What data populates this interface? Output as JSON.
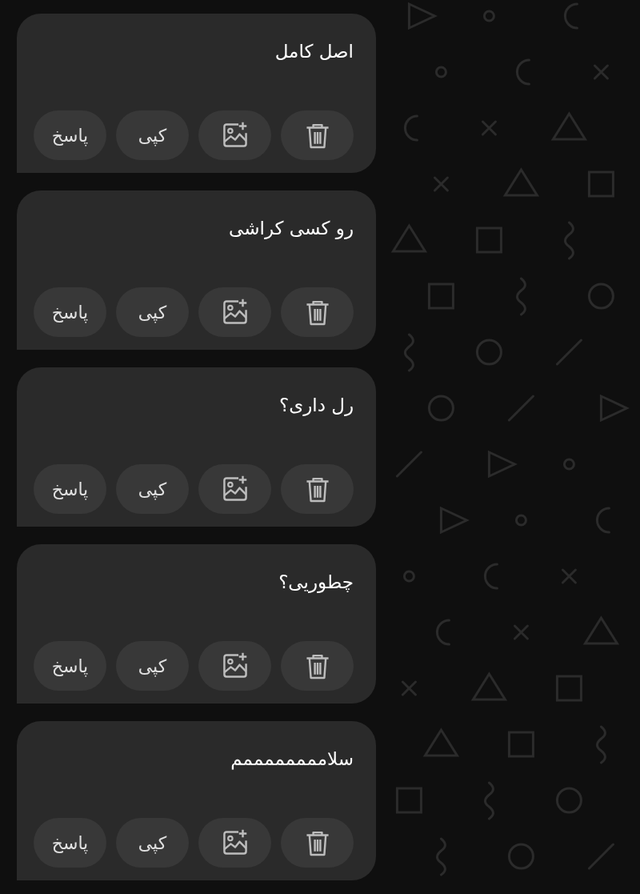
{
  "messages": [
    {
      "text": "اصل کامل",
      "actions": [
        {
          "kind": "delete"
        },
        {
          "kind": "add_image"
        },
        {
          "kind": "text",
          "label": "کپی"
        },
        {
          "kind": "text",
          "label": "پاسخ"
        }
      ]
    },
    {
      "text": "رو کسی کراشی",
      "actions": [
        {
          "kind": "delete"
        },
        {
          "kind": "add_image"
        },
        {
          "kind": "text",
          "label": "کپی"
        },
        {
          "kind": "text",
          "label": "پاسخ"
        }
      ]
    },
    {
      "text": "رل داری؟",
      "actions": [
        {
          "kind": "delete"
        },
        {
          "kind": "add_image"
        },
        {
          "kind": "text",
          "label": "کپی"
        },
        {
          "kind": "text",
          "label": "پاسخ"
        }
      ]
    },
    {
      "text": "چطوریی؟",
      "actions": [
        {
          "kind": "delete"
        },
        {
          "kind": "add_image"
        },
        {
          "kind": "text",
          "label": "کپی"
        },
        {
          "kind": "text",
          "label": "پاسخ"
        }
      ]
    },
    {
      "text": "سلاممممممممم",
      "actions": [
        {
          "kind": "delete"
        },
        {
          "kind": "add_image"
        },
        {
          "kind": "text",
          "label": "کپی"
        },
        {
          "kind": "text",
          "label": "پاسخ"
        }
      ]
    }
  ]
}
